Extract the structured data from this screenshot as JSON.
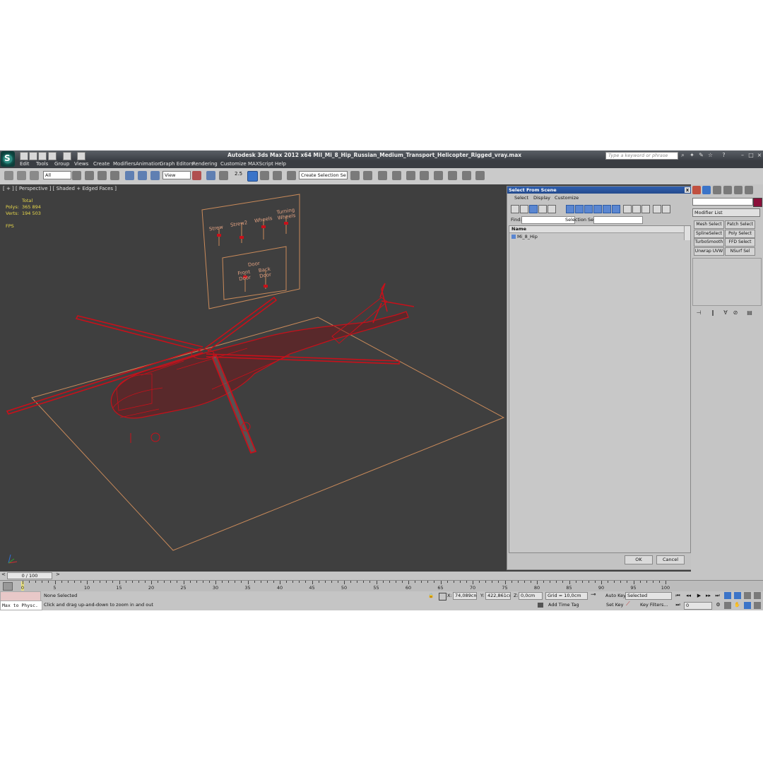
{
  "app": {
    "logo": "S",
    "title": "Autodesk 3ds Max  2012 x64     Mil_Mi_8_Hip_Russian_Medium_Transport_Helicopter_Rigged_vray.max",
    "search_placeholder": "Type a keyword or phrase"
  },
  "menu": [
    "Edit",
    "Tools",
    "Group",
    "Views",
    "Create",
    "Modifiers",
    "Animation",
    "Graph Editors",
    "Rendering",
    "Customize",
    "MAXScript",
    "Help"
  ],
  "toolbar": {
    "filter": "All",
    "view": "View",
    "snap_value": "2.5",
    "selection_set": "Create Selection Se"
  },
  "viewport": {
    "label": "[ + ] [ Perspective ] [ Shaded + Edged Faces ]",
    "stats": {
      "total_label": "Total",
      "polys_label": "Polys:",
      "polys_value": "365 894",
      "verts_label": "Verts:",
      "verts_value": "194 503",
      "fps_label": "FPS"
    },
    "control_board": {
      "sliders": [
        "Strew",
        "Strew2",
        "Wheels",
        "Turning Wheels"
      ],
      "door_title": "Door",
      "door_sliders": [
        "Front Door",
        "Back Door"
      ]
    }
  },
  "dialog": {
    "title": "Select From Scene",
    "close": "x",
    "menu": [
      "Select",
      "Display",
      "Customize"
    ],
    "find_label": "Find:",
    "selection_set_label": "Selection Set:",
    "column": "Name",
    "items": [
      "Mi_8_Hip"
    ],
    "ok": "OK",
    "cancel": "Cancel"
  },
  "command_panel": {
    "modifier_list": "Modifier List",
    "modifiers": [
      "Mesh Select",
      "Patch Select",
      "SplineSelect",
      "Poly Select",
      "TurboSmooth",
      "FFD Select",
      "Unwrap UVW",
      "NSurf Sel"
    ],
    "swatch_color": "#8b0f3a"
  },
  "timeline": {
    "frame_counter": "0 / 100",
    "ticks": [
      "0",
      "5",
      "10",
      "15",
      "20",
      "25",
      "30",
      "35",
      "40",
      "45",
      "50",
      "55",
      "60",
      "65",
      "70",
      "75",
      "80",
      "85",
      "90",
      "95",
      "100"
    ]
  },
  "status": {
    "script_text": "Max to Physc.",
    "selection": "None Selected",
    "prompt": "Click and drag up-and-down to zoom in and out",
    "x_label": "X:",
    "x_value": "74,089cm",
    "y_label": "Y:",
    "y_value": "422,861cm",
    "z_label": "Z:",
    "z_value": "0,0cm",
    "grid": "Grid = 10,0cm",
    "add_time_tag": "Add Time Tag",
    "auto_key": "Auto Key",
    "set_key": "Set Key",
    "selected": "Selected",
    "key_filters": "Key Filters...",
    "frame_value": "0"
  },
  "colors": {
    "wireframe": "#c8101a",
    "grid_plane": "#c98a5a",
    "dialog_title": "#2f5fb0"
  }
}
